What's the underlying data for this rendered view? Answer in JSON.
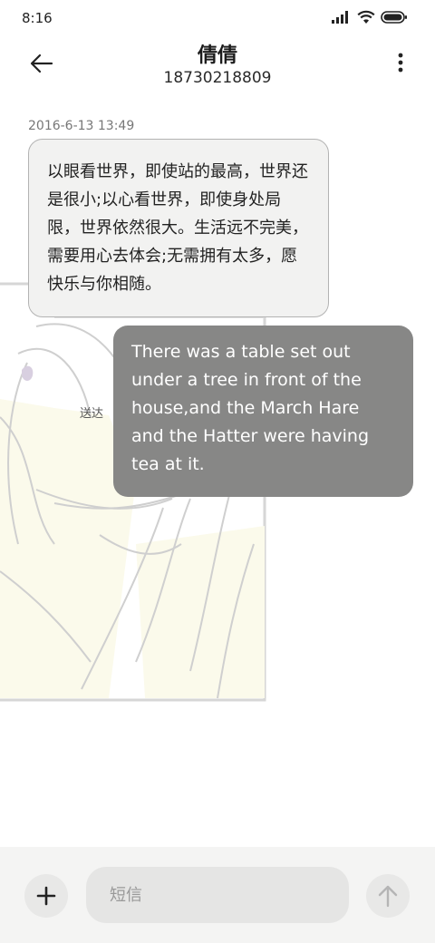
{
  "status_bar": {
    "time": "8:16"
  },
  "header": {
    "contact_name": "倩倩",
    "contact_number": "18730218809",
    "back_icon": "arrow-left-icon",
    "more_icon": "more-vertical-icon"
  },
  "conversation": {
    "timestamp": "2016-6-13 13:49",
    "messages": [
      {
        "direction": "incoming",
        "text": "以眼看世界，即使站的最高，世界还是很小;以心看世界，即使身处局限，世界依然很大。生活远不完美，需要用心去体会;无需拥有太多，愿快乐与你相随。"
      },
      {
        "direction": "outgoing",
        "text": "There was a table set out under a tree in front of the house,and the March Hare and the Hatter were having tea at it.",
        "status": "送达"
      }
    ]
  },
  "composer": {
    "placeholder": "短信",
    "value": "",
    "add_icon": "plus-icon",
    "send_icon": "arrow-up-icon"
  },
  "colors": {
    "incoming_bubble": "#f2f2f1",
    "outgoing_bubble": "#878786",
    "composer_bg": "#f4f4f3"
  }
}
